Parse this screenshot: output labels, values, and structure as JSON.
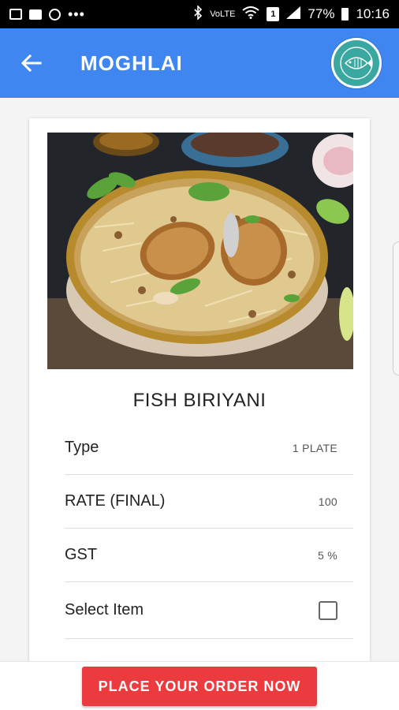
{
  "status_bar": {
    "battery_percent": "77%",
    "time": "10:16",
    "network_label": "VoLTE",
    "sim_slot": "1",
    "left_icons": [
      "image-icon",
      "chat-icon",
      "chrome-icon",
      "more-icon"
    ],
    "right_icons": [
      "bluetooth-icon",
      "volte-icon",
      "wifi-icon",
      "sim-icon",
      "signal-icon",
      "battery-icon"
    ],
    "more_dots": "•••"
  },
  "app_bar": {
    "title": "MOGHLAI",
    "color": "#3f86f0",
    "back_icon": "arrow-left-icon",
    "logo_icon": "fish-logo-icon"
  },
  "item": {
    "name": "FISH BIRIYANI",
    "image_icon": "food-photo",
    "details": [
      {
        "label": "Type",
        "value": "1 PLATE"
      },
      {
        "label": "RATE (FINAL)",
        "value": "100"
      },
      {
        "label": "GST",
        "value": "5 %"
      }
    ],
    "select_label": "Select Item",
    "select_checked": false
  },
  "order_button": {
    "label": "PLACE YOUR ORDER NOW",
    "color": "#eb3b3f"
  }
}
